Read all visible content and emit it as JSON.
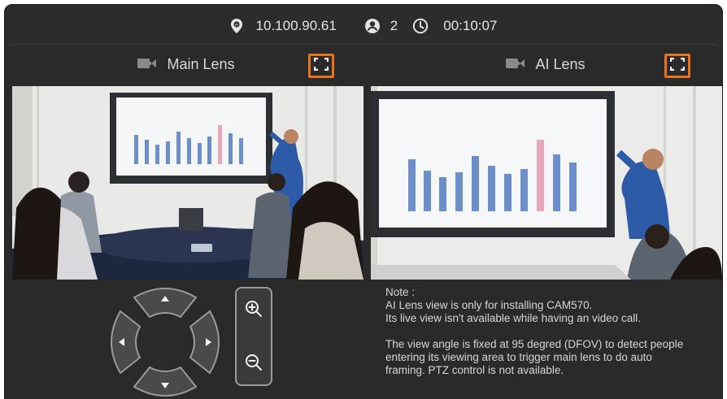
{
  "status_bar": {
    "ip_address": "10.100.90.61",
    "participants": "2",
    "elapsed_time": "00:10:07",
    "icons": [
      "location-ip-icon",
      "user-icon",
      "clock-icon"
    ]
  },
  "lenses": [
    {
      "title": "Main Lens",
      "icon": "camera-icon",
      "action": "fullscreen"
    },
    {
      "title": "AI Lens",
      "icon": "camera-icon",
      "action": "fullscreen"
    }
  ],
  "note": {
    "heading": "Note :",
    "line1": "AI Lens view is only for installing CAM570.",
    "line2": "Its live view isn't available while having an video call.",
    "line3": "The view angle is fixed at 95 degred (DFOV) to detect people",
    "line4": "entering its viewing area to trigger main lens to do auto",
    "line5": "framing. PTZ control is not available."
  },
  "controls": {
    "pan_tilt": [
      "up",
      "down",
      "left",
      "right"
    ],
    "zoom": [
      "zoom-in",
      "zoom-out"
    ]
  },
  "colors": {
    "accent": "#e8731a",
    "background": "#2c2c2c",
    "text": "#e4e4e4"
  }
}
